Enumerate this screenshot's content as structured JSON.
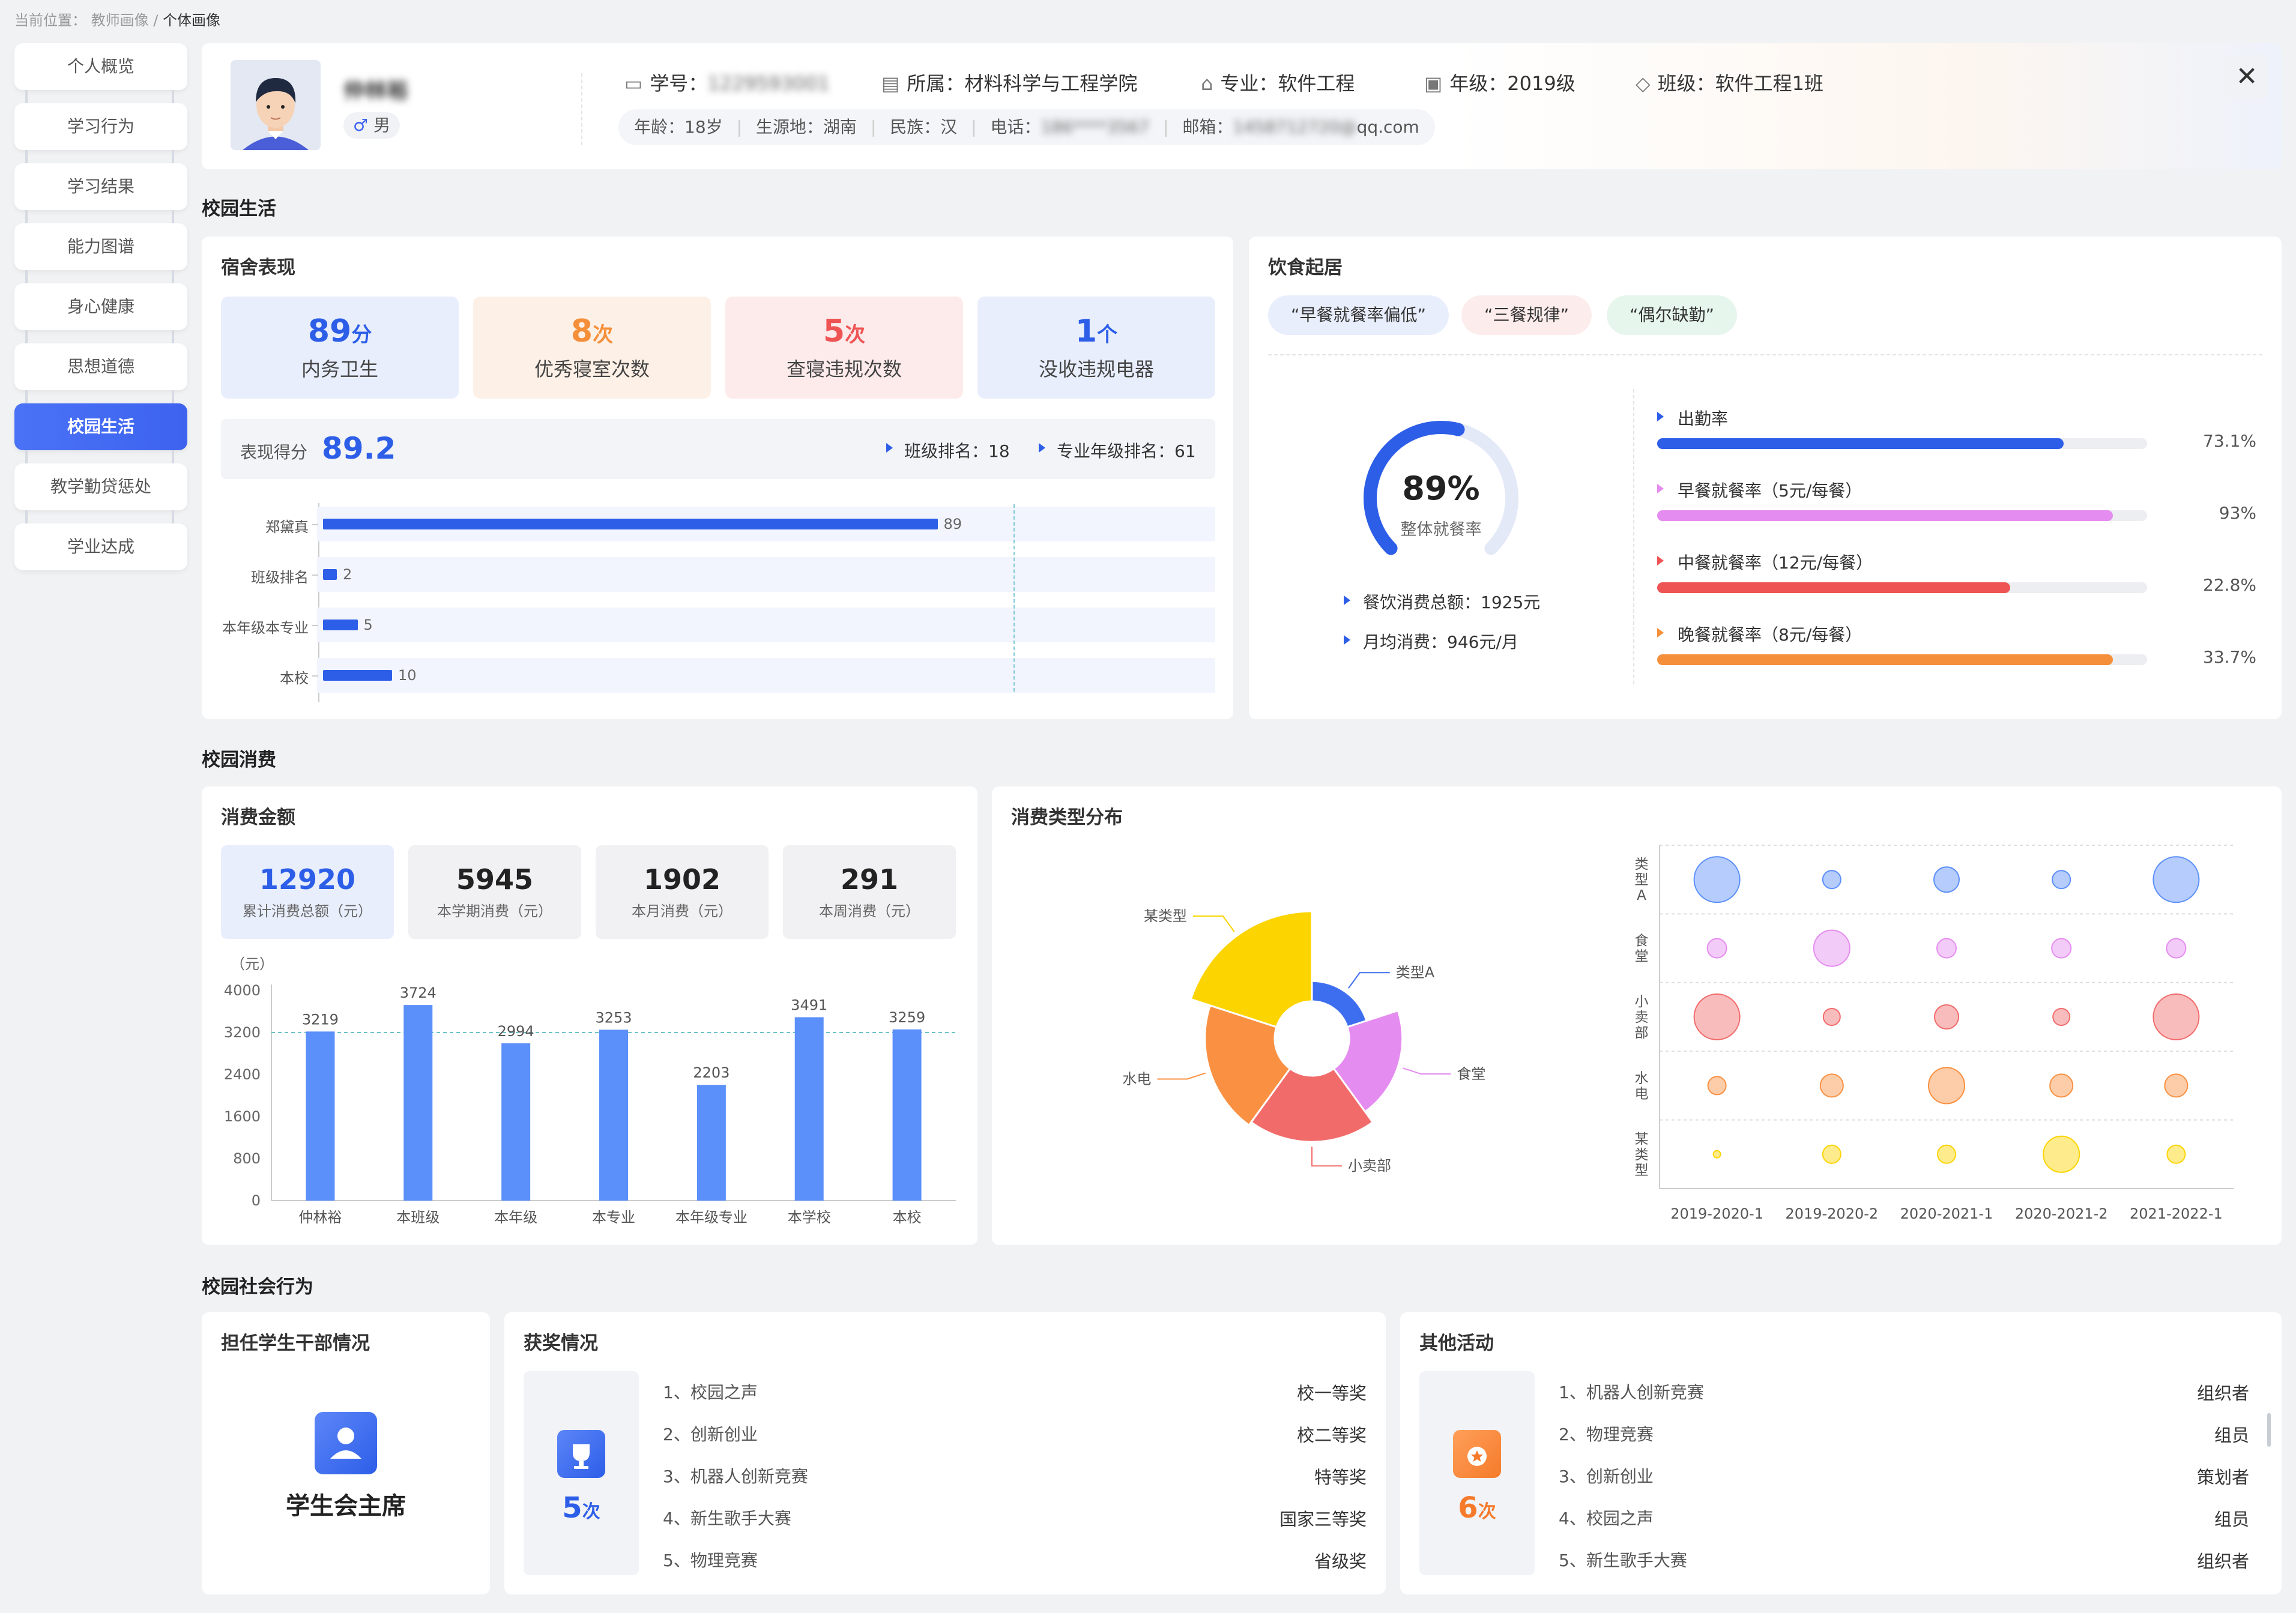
{
  "breadcrumb": {
    "prefix": "当前位置：",
    "parent": "教师画像",
    "separator": " / ",
    "current": "个体画像"
  },
  "sidebar": {
    "items": [
      {
        "label": "个人概览"
      },
      {
        "label": "学习行为"
      },
      {
        "label": "学习结果"
      },
      {
        "label": "能力图谱"
      },
      {
        "label": "身心健康"
      },
      {
        "label": "思想道德"
      },
      {
        "label": "校园生活"
      },
      {
        "label": "教学勤贷惩处"
      },
      {
        "label": "学业达成"
      }
    ],
    "active_index": 6
  },
  "profile": {
    "name": "仲林裕",
    "gender_icon": "♂",
    "gender": "男",
    "student_id_label": "学号：",
    "student_id": "1229593001",
    "dept_label": "所属：",
    "dept": "材料科学与工程学院",
    "major_label": "专业：",
    "major": "软件工程",
    "grade_label": "年级：",
    "grade": "2019级",
    "class_label": "班级：",
    "class": "软件工程1班",
    "age": "年龄：18岁",
    "origin": "生源地：湖南",
    "ethnicity": "民族：汉",
    "phone_label": "电话：",
    "phone": "186****3567",
    "email_label": "邮箱：",
    "email_hidden": "1458712720@",
    "email_domain": "qq.com"
  },
  "sections": {
    "campus_life": "校园生活",
    "campus_consumption": "校园消费",
    "social": "校园社会行为"
  },
  "dorm": {
    "title": "宿舍表现",
    "stats": [
      {
        "value": "89",
        "unit": "分",
        "label": "内务卫生",
        "color": "#2d5ee8",
        "bg": "#e8eefc"
      },
      {
        "value": "8",
        "unit": "次",
        "label": "优秀寝室次数",
        "color": "#f58f3a",
        "bg": "#fdf0e6"
      },
      {
        "value": "5",
        "unit": "次",
        "label": "查寝违规次数",
        "color": "#ef5454",
        "bg": "#fdebeb"
      },
      {
        "value": "1",
        "unit": "个",
        "label": "没收违规电器",
        "color": "#2d5ee8",
        "bg": "#e8eefc"
      }
    ],
    "score_label": "表现得分",
    "score": "89.2",
    "class_rank": "班级排名：18",
    "major_rank": "专业年级排名：61",
    "bars": [
      {
        "label": "郑黛真",
        "value": 89
      },
      {
        "label": "班级排名",
        "value": 2
      },
      {
        "label": "本年级本专业",
        "value": 5
      },
      {
        "label": "本校",
        "value": 10
      }
    ],
    "bar_max": 100
  },
  "diet": {
    "title": "饮食起居",
    "tags": [
      {
        "label": "“早餐就餐率偏低”",
        "bg": "#e9eefc"
      },
      {
        "label": "“三餐规律”",
        "bg": "#fdecec"
      },
      {
        "label": "“偶尔缺勤”",
        "bg": "#e6f6ec"
      }
    ],
    "overall_rate": "89%",
    "overall_label": "整体就餐率",
    "overall_fraction": 0.89,
    "total": "餐饮消费总额：1925元",
    "monthly": "月均消费：946元/月",
    "rates": [
      {
        "label": "出勤率",
        "value": "73.1%",
        "fill": 0.83,
        "color": "#2d5ee8"
      },
      {
        "label": "早餐就餐率（5元/每餐）",
        "value": "93%",
        "fill": 0.93,
        "color": "#e58cf0"
      },
      {
        "label": "中餐就餐率（12元/每餐）",
        "value": "22.8%",
        "fill": 0.72,
        "color": "#ef5454"
      },
      {
        "label": "晚餐就餐率（8元/每餐）",
        "value": "33.7%",
        "fill": 0.93,
        "color": "#f58f3a"
      }
    ]
  },
  "consumption": {
    "title": "消费金额",
    "stats": [
      {
        "value": "12920",
        "label": "累计消费总额（元）",
        "highlight": true
      },
      {
        "value": "5945",
        "label": "本学期消费（元）",
        "highlight": false
      },
      {
        "value": "1902",
        "label": "本月消费（元）",
        "highlight": false
      },
      {
        "value": "291",
        "label": "本周消费（元）",
        "highlight": false
      }
    ]
  },
  "type_dist": {
    "title": "消费类型分布"
  },
  "cadre": {
    "title": "担任学生干部情况",
    "role": "学生会主席"
  },
  "awards": {
    "title": "获奖情况",
    "count": "5",
    "unit": "次",
    "items": [
      {
        "name": "1、校园之声",
        "level": "校一等奖"
      },
      {
        "name": "2、创新创业",
        "level": "校二等奖"
      },
      {
        "name": "3、机器人创新竞赛",
        "level": "特等奖"
      },
      {
        "name": "4、新生歌手大赛",
        "level": "国家三等奖"
      },
      {
        "name": "5、物理竞赛",
        "level": "省级奖"
      }
    ]
  },
  "activities": {
    "title": "其他活动",
    "count": "6",
    "unit": "次",
    "items": [
      {
        "name": "1、机器人创新竞赛",
        "role": "组织者"
      },
      {
        "name": "2、物理竞赛",
        "role": "组员"
      },
      {
        "name": "3、创新创业",
        "role": "策划者"
      },
      {
        "name": "4、校园之声",
        "role": "组员"
      },
      {
        "name": "5、新生歌手大赛",
        "role": "组织者"
      }
    ]
  },
  "chart_data": [
    {
      "type": "bar",
      "title": "",
      "ylabel": "（元）",
      "categories": [
        "仲林裕",
        "本班级",
        "本年级",
        "本专业",
        "本年级专业",
        "本学校",
        "本校"
      ],
      "values": [
        3219,
        3724,
        2994,
        3253,
        2203,
        3491,
        3259
      ],
      "ylim": [
        0,
        4000
      ],
      "yticks": [
        0,
        800,
        1600,
        2400,
        3200,
        4000
      ],
      "reference_line": 3200,
      "color": "#5b8ff9"
    },
    {
      "type": "pie",
      "subtype": "nightingale-rose",
      "categories": [
        "类型A",
        "食堂",
        "小卖部",
        "水电",
        "某类型"
      ],
      "values": [
        22,
        58,
        72,
        76,
        98
      ],
      "colors": [
        "#3e6ef0",
        "#e58cf0",
        "#f26b6b",
        "#fa9142",
        "#fcd400"
      ]
    },
    {
      "type": "scatter",
      "subtype": "bubble",
      "x": [
        "2019-2020-1",
        "2019-2020-2",
        "2020-2021-1",
        "2020-2021-2",
        "2021-2022-1"
      ],
      "y": [
        "类型A",
        "食堂",
        "小卖部",
        "水电",
        "某类型"
      ],
      "sizes": [
        [
          38,
          15,
          21,
          15,
          38
        ],
        [
          16,
          30,
          16,
          16,
          16
        ],
        [
          38,
          14,
          20,
          14,
          38
        ],
        [
          15,
          19,
          30,
          19,
          19
        ],
        [
          6,
          15,
          15,
          30,
          15
        ]
      ],
      "colors": [
        "#5b8ff9",
        "#e58cf0",
        "#f26b6b",
        "#fa9142",
        "#fcd400"
      ]
    }
  ]
}
